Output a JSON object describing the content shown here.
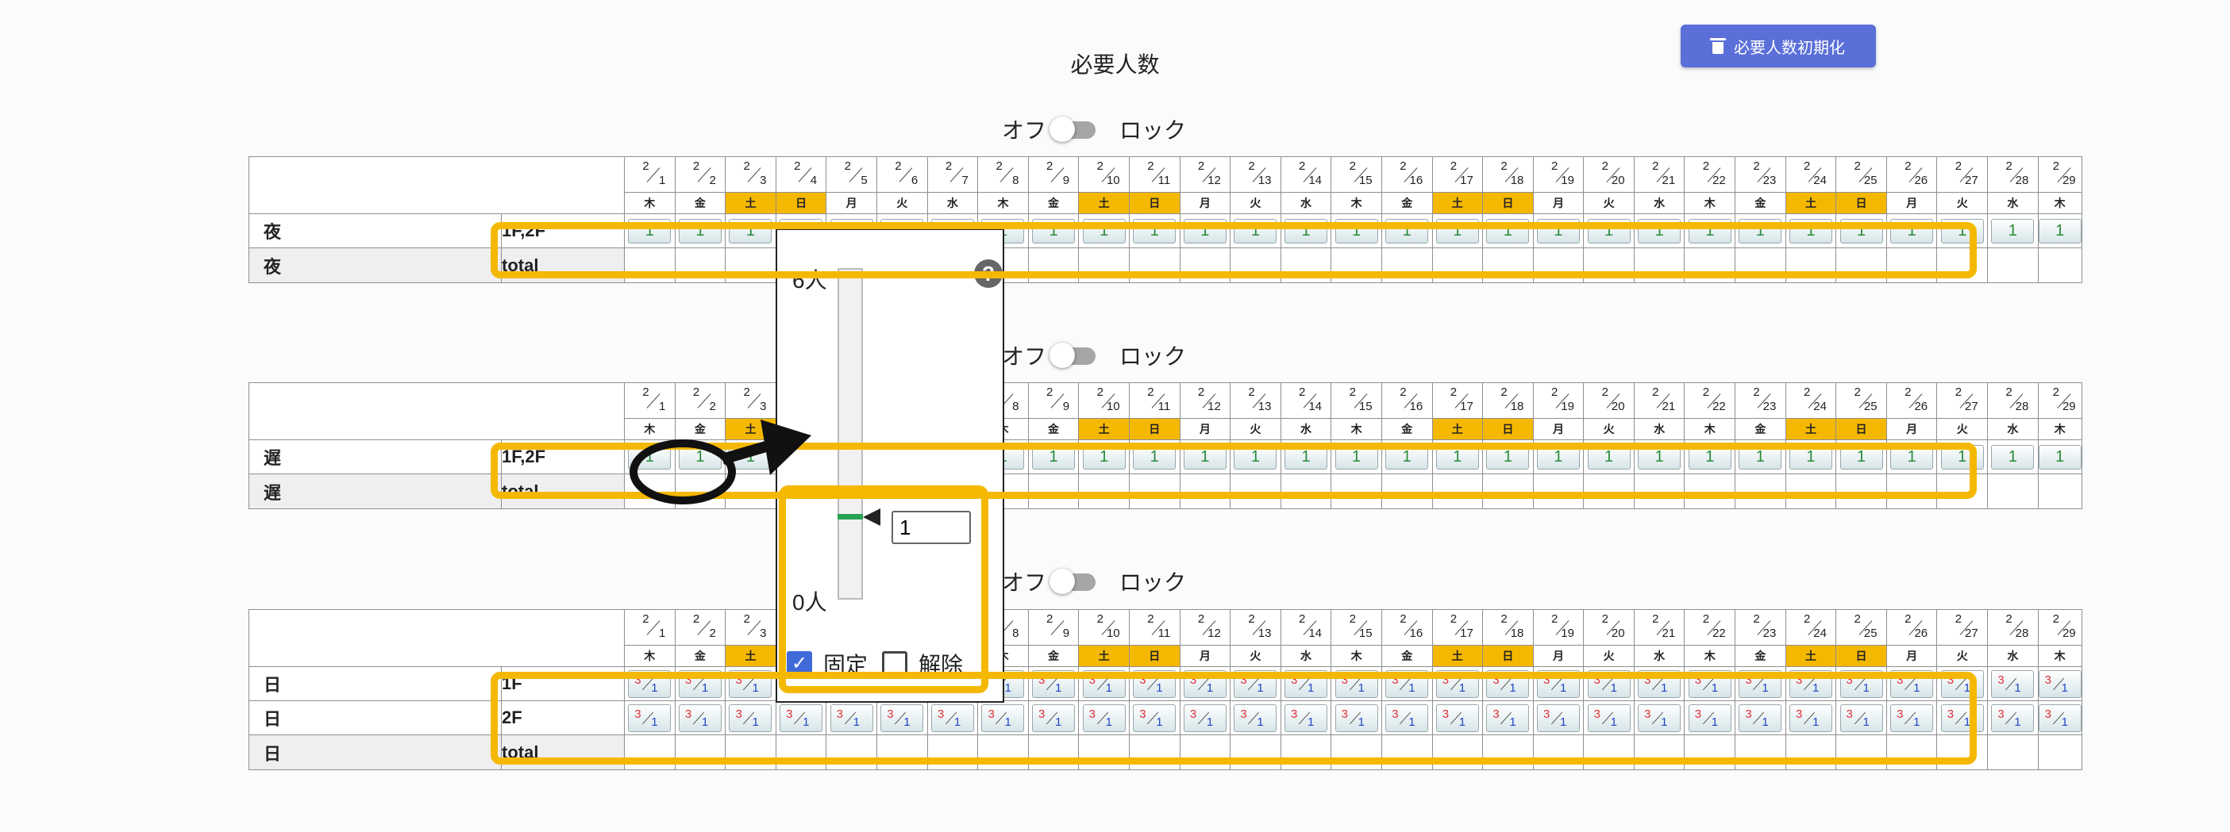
{
  "page": {
    "title": "必要人数",
    "reset_button": "必要人数初期化",
    "toggle_off_label": "オフ",
    "toggle_on_label": "ロック"
  },
  "dates": [
    {
      "m": "2",
      "d": "1",
      "w": "木"
    },
    {
      "m": "2",
      "d": "2",
      "w": "金"
    },
    {
      "m": "2",
      "d": "3",
      "w": "土"
    },
    {
      "m": "2",
      "d": "4",
      "w": "日"
    },
    {
      "m": "2",
      "d": "5",
      "w": "月"
    },
    {
      "m": "2",
      "d": "6",
      "w": "火"
    },
    {
      "m": "2",
      "d": "7",
      "w": "水"
    },
    {
      "m": "2",
      "d": "8",
      "w": "木"
    },
    {
      "m": "2",
      "d": "9",
      "w": "金"
    },
    {
      "m": "2",
      "d": "10",
      "w": "土"
    },
    {
      "m": "2",
      "d": "11",
      "w": "日"
    },
    {
      "m": "2",
      "d": "12",
      "w": "月"
    },
    {
      "m": "2",
      "d": "13",
      "w": "火"
    },
    {
      "m": "2",
      "d": "14",
      "w": "水"
    },
    {
      "m": "2",
      "d": "15",
      "w": "木"
    },
    {
      "m": "2",
      "d": "16",
      "w": "金"
    },
    {
      "m": "2",
      "d": "17",
      "w": "土"
    },
    {
      "m": "2",
      "d": "18",
      "w": "日"
    },
    {
      "m": "2",
      "d": "19",
      "w": "月"
    },
    {
      "m": "2",
      "d": "20",
      "w": "火"
    },
    {
      "m": "2",
      "d": "21",
      "w": "水"
    },
    {
      "m": "2",
      "d": "22",
      "w": "木"
    },
    {
      "m": "2",
      "d": "23",
      "w": "金"
    },
    {
      "m": "2",
      "d": "24",
      "w": "土"
    },
    {
      "m": "2",
      "d": "25",
      "w": "日"
    },
    {
      "m": "2",
      "d": "26",
      "w": "月"
    },
    {
      "m": "2",
      "d": "27",
      "w": "火"
    },
    {
      "m": "2",
      "d": "28",
      "w": "水"
    },
    {
      "m": "2",
      "d": "29",
      "w": "木"
    }
  ],
  "weekend_days": [
    "土",
    "日"
  ],
  "sections": [
    {
      "rows": [
        {
          "shift": "夜",
          "floor": "1F,2F",
          "type": "single",
          "value": "1"
        },
        {
          "shift": "夜",
          "floor": "total",
          "type": "total"
        }
      ]
    },
    {
      "rows": [
        {
          "shift": "遅",
          "floor": "1F,2F",
          "type": "single",
          "value": "1"
        },
        {
          "shift": "遅",
          "floor": "total",
          "type": "total"
        }
      ]
    },
    {
      "rows": [
        {
          "shift": "日",
          "floor": "1F",
          "type": "frac",
          "top": "3",
          "bottom": "1"
        },
        {
          "shift": "日",
          "floor": "2F",
          "type": "frac",
          "top": "3",
          "bottom": "1"
        },
        {
          "shift": "日",
          "floor": "total",
          "type": "total"
        }
      ]
    }
  ],
  "popup": {
    "help": "?",
    "max_label": "6人",
    "min_label": "0人",
    "max_value": 6,
    "current_value": 1,
    "input_value": "1",
    "fixed_label": "固定",
    "fixed_checked": true,
    "release_label": "解除",
    "release_checked": false
  }
}
